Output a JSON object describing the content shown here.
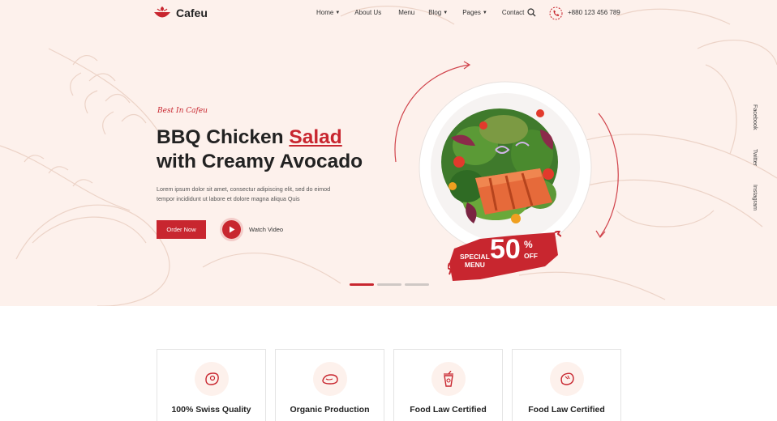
{
  "brand": {
    "name": "Cafeu",
    "accent": "#c8262f",
    "hero_bg": "#fdf1ec"
  },
  "nav": {
    "items": [
      {
        "label": "Home",
        "dropdown": true
      },
      {
        "label": "About Us",
        "dropdown": false
      },
      {
        "label": "Menu",
        "dropdown": false
      },
      {
        "label": "Blog",
        "dropdown": true
      },
      {
        "label": "Pages",
        "dropdown": true
      },
      {
        "label": "Contact",
        "dropdown": false
      }
    ],
    "search_icon": "search-icon",
    "phone_icon": "phone-icon",
    "phone": "+880 123 456 789"
  },
  "hero": {
    "tagline": "Best In Cafeu",
    "title_line1_part1": "BBQ Chicken ",
    "title_line1_accent": "Salad",
    "title_line2": "with Creamy Avocado",
    "lead_line1": "Lorem ipsum dolor sit amet, consectur adipiscing elit, sed do eimod",
    "lead_line2": "tempor incididunt ut labore et dolore magna aliqua Quis",
    "order_button": "Order Now",
    "watch_video": "Watch Video",
    "badge_special_line1": "SPECIAL",
    "badge_special_line2": "MENU",
    "badge_value": "50",
    "badge_percent": "%",
    "badge_off": "OFF",
    "slides": 3,
    "active_slide": 1
  },
  "social": [
    "Facebook",
    "Twitter",
    "Instagram"
  ],
  "features": [
    {
      "title": "100% Swiss Quality",
      "icon": "meat-icon"
    },
    {
      "title": "Organic Production",
      "icon": "chicken-icon"
    },
    {
      "title": "Food Law Certified",
      "icon": "drink-cup-icon"
    },
    {
      "title": "Food Law Certified",
      "icon": "shrimp-icon"
    }
  ]
}
